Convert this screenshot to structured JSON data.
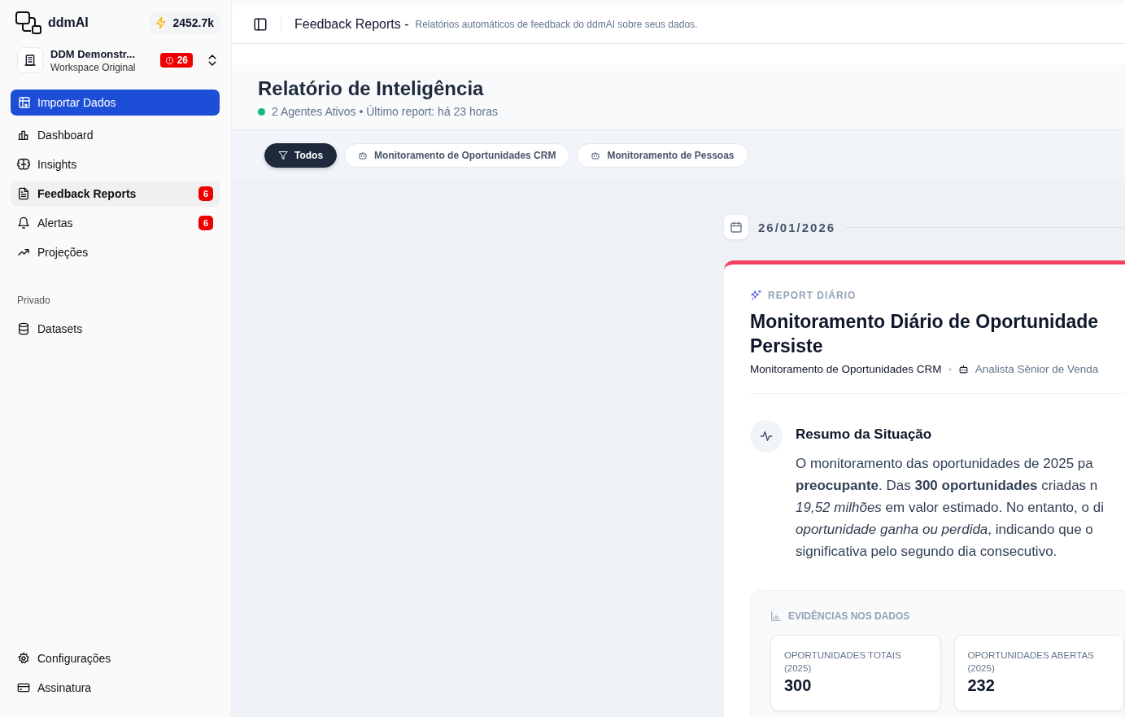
{
  "brand": {
    "name": "ddmAI",
    "credits": "2452.7k"
  },
  "workspace": {
    "name": "DDM Demonstr...",
    "subtitle": "Workspace Original",
    "alert_count": "26"
  },
  "primary_action": {
    "label": "Importar Dados"
  },
  "nav": [
    {
      "kind": "chart",
      "label": "Dashboard",
      "selected": false
    },
    {
      "kind": "brain",
      "label": "Insights",
      "selected": false
    },
    {
      "kind": "file",
      "label": "Feedback Reports",
      "selected": true,
      "badge": "6"
    },
    {
      "kind": "bell",
      "label": "Alertas",
      "selected": false,
      "badge": "6"
    },
    {
      "kind": "trend",
      "label": "Projeções",
      "selected": false
    }
  ],
  "private_section": {
    "heading": "Privado",
    "items": [
      {
        "kind": "database",
        "label": "Datasets",
        "selected": false
      }
    ]
  },
  "footer_nav": [
    {
      "kind": "gear",
      "label": "Configurações",
      "selected": false
    },
    {
      "kind": "card",
      "label": "Assinatura",
      "selected": false
    }
  ],
  "header": {
    "title": "Feedback Reports -",
    "subtitle": "Relatórios automáticos de feedback do ddmAI sobre seus dados."
  },
  "hero": {
    "title": "Relatório de Inteligência",
    "status": "2 Agentes Ativos • Último report: há 23 horas"
  },
  "filters": [
    {
      "kind": "funnel",
      "label": "Todos",
      "selected": true
    },
    {
      "kind": "bot",
      "label": "Monitoramento de Oportunidades CRM",
      "selected": false
    },
    {
      "kind": "bot",
      "label": "Monitoramento de Pessoas",
      "selected": false
    }
  ],
  "timeline": {
    "date": "26/01/2026",
    "report": {
      "kind_label": "REPORT DIÁRIO",
      "title_lines": [
        "Monitoramento Diário de Oportunidade",
        "Persiste"
      ],
      "agent": "Monitoramento de Oportunidades CRM",
      "analyst": "Analista Sênior de Venda",
      "summary": {
        "heading": "Resumo da Situação",
        "lines": [
          "O monitoramento das oportunidades de 2025 pa",
          "**preocupante**. Das **300 oportunidades** criadas n",
          "*19,52 milhões* em valor estimado. No entanto, o di",
          "*oportunidade ganha ou perdida*, indicando que o",
          "significativa pelo segundo dia consecutivo."
        ]
      },
      "evidence": {
        "heading": "EVIDÊNCIAS NOS DADOS",
        "stats": [
          {
            "label": "OPORTUNIDADES TOTAIS (2025)",
            "value": "300"
          },
          {
            "label": "OPORTUNIDADES ABERTAS (2025)",
            "value": "232"
          }
        ]
      }
    }
  }
}
